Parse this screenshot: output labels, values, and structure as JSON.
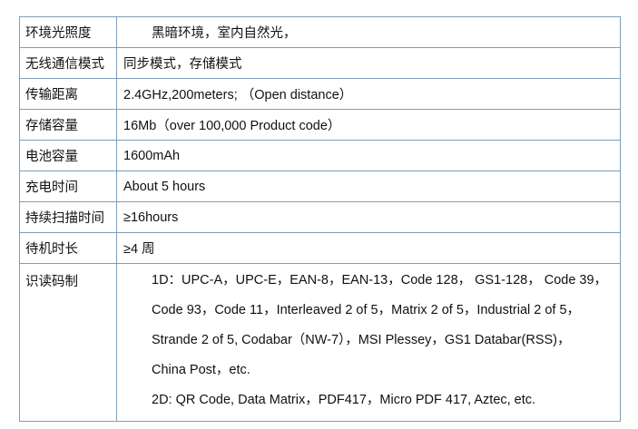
{
  "rows": [
    {
      "label": "环境光照度",
      "value": "黑暗环境，室内自然光，"
    },
    {
      "label": "无线通信模式",
      "value": "同步模式，存储模式"
    },
    {
      "label": "传输距离",
      "value": "2.4GHz,200meters; （Open distance）"
    },
    {
      "label": "存储容量",
      "value": "16Mb（over 100,000 Product code）"
    },
    {
      "label": "电池容量",
      "value": "1600mAh"
    },
    {
      "label": "充电时间",
      "value": "About 5 hours"
    },
    {
      "label": "持续扫描时间",
      "value": "≥16hours"
    },
    {
      "label": "待机时长",
      "value": "≥4 周"
    }
  ],
  "symbologies": {
    "label": "识读码制",
    "lines": [
      "1D：UPC-A，UPC-E，EAN-8，EAN-13，Code 128， GS1-128， Code 39，",
      "Code 93，Code 11，Interleaved 2 of 5，Matrix 2 of 5，Industrial 2 of 5，",
      "Strande 2 of 5, Codabar（NW-7），MSI Plessey，GS1 Databar(RSS)，",
      "China Post，etc.",
      "2D: QR Code, Data Matrix，PDF417，Micro PDF 417, Aztec, etc."
    ]
  }
}
